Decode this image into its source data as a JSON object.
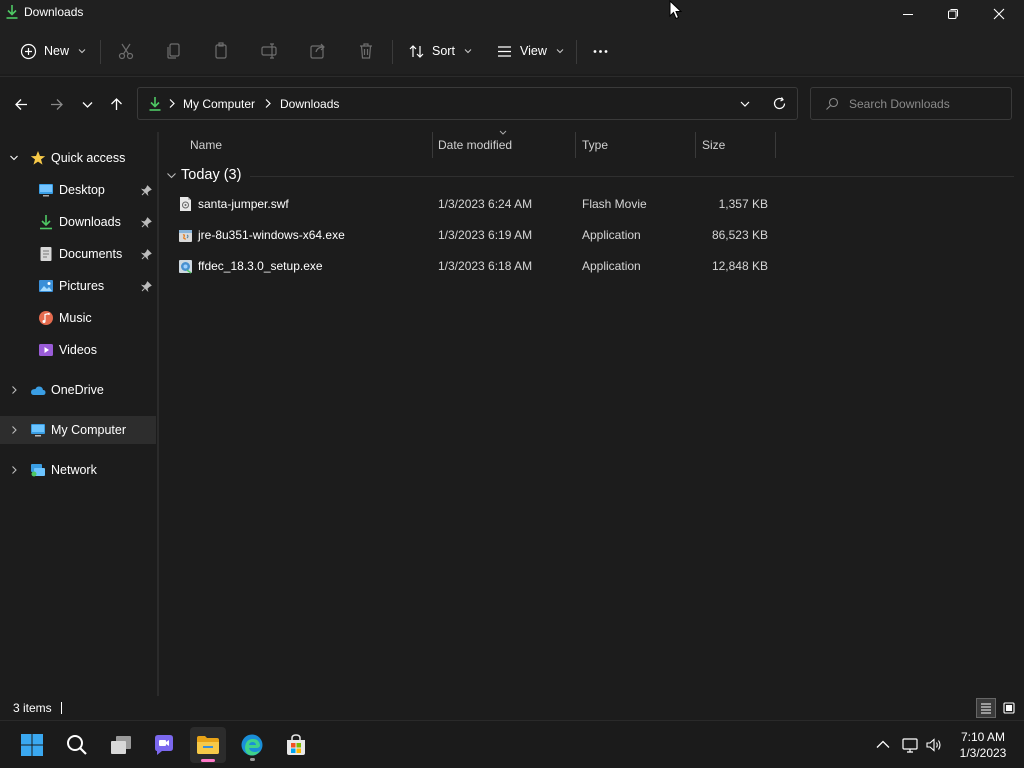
{
  "window": {
    "title": "Downloads",
    "icons": {
      "app": "download-icon",
      "minimize": "minimize-icon",
      "maximize": "restore-icon",
      "close": "close-icon"
    }
  },
  "commandbar": {
    "new_label": "New",
    "sort_label": "Sort",
    "view_label": "View",
    "icons": [
      "plus-circle-icon",
      "cut-icon",
      "copy-icon",
      "paste-icon",
      "rename-icon",
      "share-icon",
      "delete-icon",
      "sort-icon",
      "view-icon",
      "more-icon"
    ]
  },
  "address": {
    "crumbs": [
      "My Computer",
      "Downloads"
    ],
    "icons": [
      "download-icon",
      "chevron-down-icon",
      "refresh-icon"
    ]
  },
  "search": {
    "placeholder": "Search Downloads"
  },
  "sidebar": {
    "quick_access": "Quick access",
    "items": [
      {
        "label": "Desktop",
        "icon": "desktop-icon",
        "pinned": true
      },
      {
        "label": "Downloads",
        "icon": "download-icon",
        "pinned": true
      },
      {
        "label": "Documents",
        "icon": "documents-icon",
        "pinned": true
      },
      {
        "label": "Pictures",
        "icon": "pictures-icon",
        "pinned": true
      },
      {
        "label": "Music",
        "icon": "music-icon",
        "pinned": false
      },
      {
        "label": "Videos",
        "icon": "videos-icon",
        "pinned": false
      }
    ],
    "onedrive": "OneDrive",
    "my_computer": "My Computer",
    "network": "Network"
  },
  "columns": {
    "name": "Name",
    "date": "Date modified",
    "type": "Type",
    "size": "Size"
  },
  "group": {
    "title": "Today (3)"
  },
  "files": [
    {
      "name": "santa-jumper.swf",
      "date": "1/3/2023 6:24 AM",
      "type": "Flash Movie",
      "size": "1,357 KB",
      "icon": "swf-file-icon"
    },
    {
      "name": "jre-8u351-windows-x64.exe",
      "date": "1/3/2023 6:19 AM",
      "type": "Application",
      "size": "86,523 KB",
      "icon": "java-installer-icon"
    },
    {
      "name": "ffdec_18.3.0_setup.exe",
      "date": "1/3/2023 6:18 AM",
      "type": "Application",
      "size": "12,848 KB",
      "icon": "installer-icon"
    }
  ],
  "status": {
    "count": "3 items"
  },
  "taskbar": {
    "apps": [
      "windows-start-icon",
      "search-icon",
      "task-view-icon",
      "teams-chat-icon",
      "file-explorer-icon",
      "edge-icon",
      "store-icon"
    ],
    "time": "7:10 AM",
    "date": "1/3/2023",
    "tray": [
      "chevron-up-icon",
      "network-icon",
      "volume-icon"
    ]
  },
  "colors": {
    "background": "#1c1c1c",
    "chrome": "#202020",
    "accent_green": "#4ec964",
    "folder_yellow": "#f7c948",
    "selection": "#2d2d2d"
  }
}
